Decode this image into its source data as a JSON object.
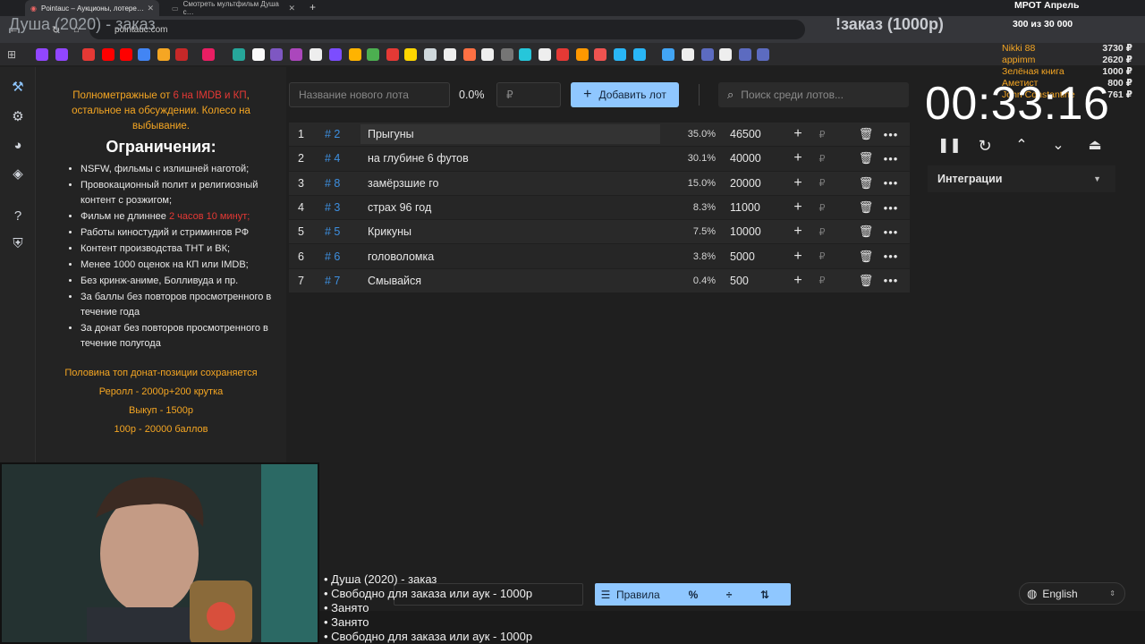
{
  "browser": {
    "tabs": [
      {
        "title": "Pointauc – Аукционы, лотере…",
        "active": true
      },
      {
        "title": "Смотреть мультфильм Душа с…",
        "active": false
      }
    ],
    "url": "pointauc.com"
  },
  "overlay": {
    "stream_title": "Душа (2020) - заказ",
    "order_title": "!заказ (1000р)",
    "mrot_label": "МРОТ Апрель",
    "counter": "300  из 30 000",
    "donors": [
      {
        "name": "Nikki 88",
        "amount": "3730 ₽"
      },
      {
        "name": "appimm",
        "amount": "2620 ₽"
      },
      {
        "name": "Зелёная книга",
        "amount": "1000 ₽"
      },
      {
        "name": "Аметист",
        "amount": "800 ₽"
      },
      {
        "name": "John Constantine",
        "amount": "761 ₽"
      }
    ]
  },
  "rules": {
    "intro_a": "Полнометражные от ",
    "intro_b": "6 на IMDB и КП",
    "intro_c": ", остальное на обсуждении. Колесо на выбывание.",
    "heading": "Ограничения:",
    "items": [
      "NSFW, фильмы с излишней наготой;",
      "Провокационный полит и религиозный контент с розжигом;",
      "Фильм не длиннее ",
      "Работы киностудий и стримингов РФ",
      "Контент производства ТНТ и ВК;",
      "Менее 1000 оценок на КП или IMDB;",
      "Без кринж-аниме, Болливуда и пр.",
      "За баллы без повторов просмотренного в течение года",
      "За донат без повторов просмотренного в течение полугода"
    ],
    "duration_limit": "2 часов 10 минут;",
    "footer": [
      "Половина топ донат-позиции сохраняется",
      "Реролл - 2000р+200 крутка",
      "Выкуп - 1500р",
      "100р - 20000 баллов"
    ]
  },
  "new_lot": {
    "name_placeholder": "Название нового лота",
    "percent": "0.0%",
    "amount_placeholder": "₽",
    "add_label": "Добавить лот"
  },
  "search": {
    "placeholder": "Поиск среди лотов..."
  },
  "lots": [
    {
      "idx": "1",
      "id": "# 2",
      "name": "Прыгуны",
      "pct": "35.0%",
      "amount": "46500"
    },
    {
      "idx": "2",
      "id": "# 4",
      "name": "на глубине 6 футов",
      "pct": "30.1%",
      "amount": "40000"
    },
    {
      "idx": "3",
      "id": "# 8",
      "name": "замёрзшие го",
      "pct": "15.0%",
      "amount": "20000"
    },
    {
      "idx": "4",
      "id": "# 3",
      "name": "страх 96 год",
      "pct": "8.3%",
      "amount": "11000"
    },
    {
      "idx": "5",
      "id": "# 5",
      "name": "Крикуны",
      "pct": "7.5%",
      "amount": "10000"
    },
    {
      "idx": "6",
      "id": "# 6",
      "name": "головоломка",
      "pct": "3.8%",
      "amount": "5000"
    },
    {
      "idx": "7",
      "id": "# 7",
      "name": "Смывайся",
      "pct": "0.4%",
      "amount": "500"
    }
  ],
  "rub_sign": "₽",
  "timer": {
    "value": "00:33:16"
  },
  "integrations_label": "Интеграции",
  "bottom": {
    "bullets": [
      "• Душа (2020) - заказ",
      "• Свободно для заказа или аук - 1000р",
      "• Занято",
      "• Занято",
      "• Свободно для заказа или аук - 1000р"
    ],
    "rules_label": "Правила",
    "language": "English"
  },
  "colors": {
    "accent": "#8fc7ff",
    "link": "#3d8fe0",
    "highlight": "#f5a623",
    "danger": "#e53935"
  }
}
